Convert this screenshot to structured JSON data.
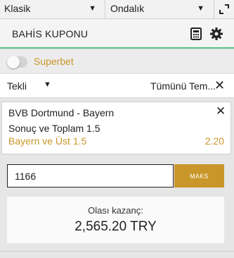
{
  "selectors": {
    "left": {
      "value": "Klasik",
      "caret": "▼"
    },
    "right": {
      "value": "Ondalık",
      "caret": "▼"
    }
  },
  "header": {
    "title": "BAHİS KUPONU"
  },
  "superbet": {
    "label": "Superbet",
    "enabled": false
  },
  "bet_type": {
    "label": "Tekli",
    "caret": "▼",
    "remove_all": "Tümünü Tem...",
    "remove_x": "✕"
  },
  "bet": {
    "event": "BVB Dortmund - Bayern",
    "market": "Sonuç ve Toplam 1.5",
    "selection": "Bayern ve Üst 1.5",
    "odds": "2.20",
    "close": "✕"
  },
  "stake": {
    "value": "1166",
    "max_label": "MAKS"
  },
  "payout": {
    "label": "Olası kazanç:",
    "value": "2,565.20 TRY"
  },
  "colors": {
    "accent": "#c9962a",
    "header_underline": "#56c08a"
  },
  "icons": {
    "calculator": "calculator-icon",
    "settings": "gear-icon",
    "expand": "expand-icon"
  }
}
